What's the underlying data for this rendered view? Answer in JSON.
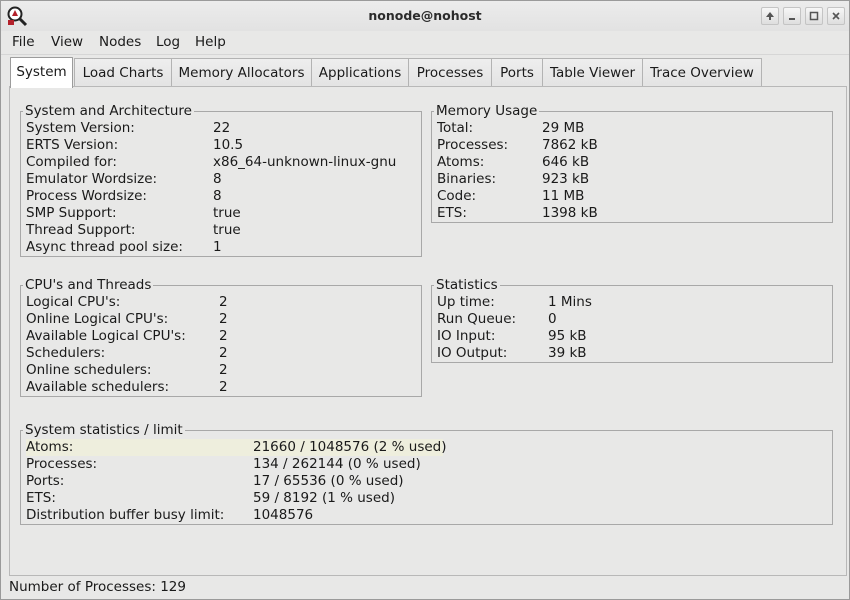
{
  "window": {
    "title": "nonode@nohost"
  },
  "menu": [
    "File",
    "View",
    "Nodes",
    "Log",
    "Help"
  ],
  "tabs": [
    "System",
    "Load Charts",
    "Memory Allocators",
    "Applications",
    "Processes",
    "Ports",
    "Table Viewer",
    "Trace Overview"
  ],
  "active_tab": "System",
  "system_arch": {
    "title": "System and Architecture",
    "rows": [
      {
        "k": "System Version:",
        "v": "22"
      },
      {
        "k": "ERTS Version:",
        "v": "10.5"
      },
      {
        "k": "Compiled for:",
        "v": "x86_64-unknown-linux-gnu"
      },
      {
        "k": "Emulator Wordsize:",
        "v": "8"
      },
      {
        "k": "Process Wordsize:",
        "v": "8"
      },
      {
        "k": "SMP Support:",
        "v": "true"
      },
      {
        "k": "Thread Support:",
        "v": "true"
      },
      {
        "k": "Async thread pool size:",
        "v": "1"
      }
    ]
  },
  "memory": {
    "title": "Memory Usage",
    "rows": [
      {
        "k": "Total:",
        "v": "29 MB"
      },
      {
        "k": "Processes:",
        "v": "7862 kB"
      },
      {
        "k": "Atoms:",
        "v": "646 kB"
      },
      {
        "k": "Binaries:",
        "v": "923 kB"
      },
      {
        "k": "Code:",
        "v": "11 MB"
      },
      {
        "k": "ETS:",
        "v": "1398 kB"
      }
    ]
  },
  "cpu": {
    "title": "CPU's and Threads",
    "rows": [
      {
        "k": "Logical CPU's:",
        "v": "2"
      },
      {
        "k": "Online Logical CPU's:",
        "v": "2"
      },
      {
        "k": "Available Logical CPU's:",
        "v": "2"
      },
      {
        "k": "Schedulers:",
        "v": "2"
      },
      {
        "k": "Online schedulers:",
        "v": "2"
      },
      {
        "k": "Available schedulers:",
        "v": "2"
      }
    ]
  },
  "stats": {
    "title": "Statistics",
    "rows": [
      {
        "k": "Up time:",
        "v": "1 Mins"
      },
      {
        "k": "Run Queue:",
        "v": "0"
      },
      {
        "k": "IO Input:",
        "v": "95 kB"
      },
      {
        "k": "IO Output:",
        "v": "39 kB"
      }
    ]
  },
  "limits": {
    "title": "System statistics / limit",
    "rows": [
      {
        "k": "Atoms:",
        "v": "21660 / 1048576 (2 % used)"
      },
      {
        "k": "Processes:",
        "v": "134 / 262144 (0 % used)"
      },
      {
        "k": "Ports:",
        "v": "17 / 65536 (0 % used)"
      },
      {
        "k": "ETS:",
        "v": "59 / 8192 (1 % used)"
      },
      {
        "k": "Distribution buffer busy limit:",
        "v": "1048576"
      }
    ]
  },
  "status_bar": "Number of Processes: 129"
}
